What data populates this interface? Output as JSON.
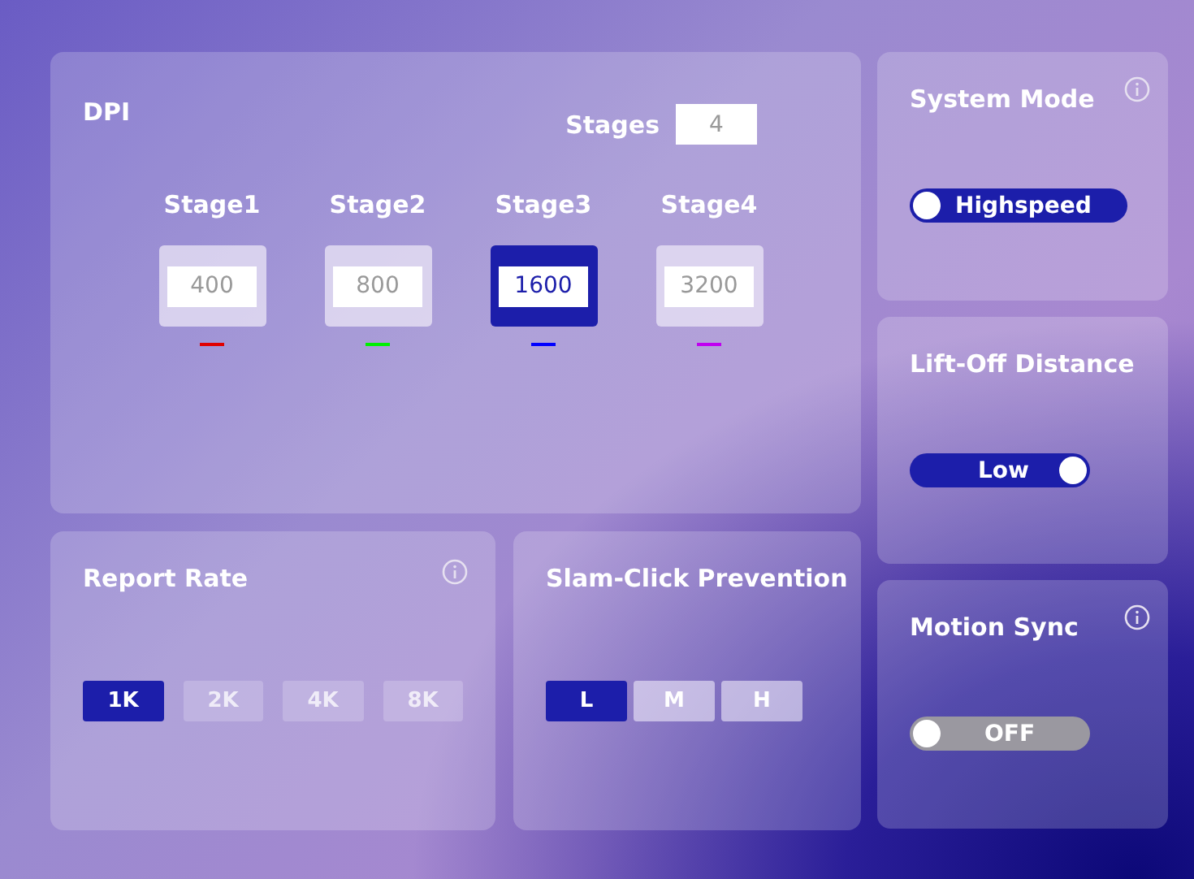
{
  "dpi": {
    "title": "DPI",
    "stages_label": "Stages",
    "stages_value": "4",
    "stages": [
      {
        "label": "Stage1",
        "value": "400",
        "selected": false,
        "color": "#e00000"
      },
      {
        "label": "Stage2",
        "value": "800",
        "selected": false,
        "color": "#00f000"
      },
      {
        "label": "Stage3",
        "value": "1600",
        "selected": true,
        "color": "#0000ff"
      },
      {
        "label": "Stage4",
        "value": "3200",
        "selected": false,
        "color": "#c000f0"
      }
    ]
  },
  "report_rate": {
    "title": "Report Rate",
    "info": true,
    "options": [
      {
        "label": "1K",
        "selected": true,
        "disabled": false
      },
      {
        "label": "2K",
        "selected": false,
        "disabled": true
      },
      {
        "label": "4K",
        "selected": false,
        "disabled": true
      },
      {
        "label": "8K",
        "selected": false,
        "disabled": true
      }
    ]
  },
  "slam_click": {
    "title": "Slam-Click Prevention",
    "info": false,
    "options": [
      {
        "label": "L",
        "selected": true
      },
      {
        "label": "M",
        "selected": false
      },
      {
        "label": "H",
        "selected": false
      }
    ]
  },
  "side_cards": [
    {
      "title": "System Mode",
      "info": true,
      "toggle": {
        "label": "Highspeed",
        "on": true,
        "knob_right": false
      }
    },
    {
      "title": "Lift-Off Distance",
      "info": false,
      "toggle": {
        "label": "Low",
        "on": true,
        "knob_right": true
      }
    },
    {
      "title": "Motion Sync",
      "info": true,
      "toggle": {
        "label": "OFF",
        "on": false,
        "knob_right": false
      }
    }
  ]
}
